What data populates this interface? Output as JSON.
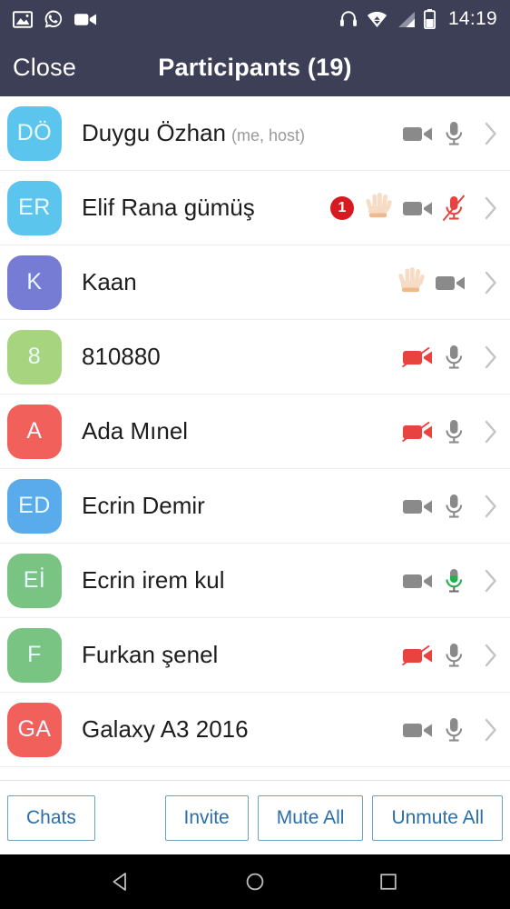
{
  "statusbar": {
    "left_icons": [
      "photo-icon",
      "whatsapp-icon",
      "video-call-icon"
    ],
    "right_icons": [
      "headset-icon",
      "wifi-icon",
      "cellular-signal-icon",
      "battery-icon"
    ],
    "time": "14:19",
    "bg_color": "#3d3f56"
  },
  "titlebar": {
    "close_label": "Close",
    "title": "Participants (19)",
    "bg_color": "#3d3f56"
  },
  "participants": [
    {
      "initials": "DÖ",
      "avatar_color": "#5bc5ee",
      "name": "Duygu Özhan",
      "meta": "(me, host)",
      "hand_raised": false,
      "badge": null,
      "video": "on",
      "mic": "on"
    },
    {
      "initials": "ER",
      "avatar_color": "#5bc5ee",
      "name": "Elif Rana gümüş",
      "meta": "",
      "hand_raised": true,
      "badge": "1",
      "video": "on",
      "mic": "muted"
    },
    {
      "initials": "K",
      "avatar_color": "#767cd4",
      "name": "Kaan",
      "meta": "",
      "hand_raised": true,
      "badge": null,
      "video": "on",
      "mic": "none"
    },
    {
      "initials": "8",
      "avatar_color": "#a7d47e",
      "name": "810880",
      "meta": "",
      "hand_raised": false,
      "badge": null,
      "video": "off",
      "mic": "on"
    },
    {
      "initials": "A",
      "avatar_color": "#f2605c",
      "name": "Ada Mınel",
      "meta": "",
      "hand_raised": false,
      "badge": null,
      "video": "off",
      "mic": "on"
    },
    {
      "initials": "ED",
      "avatar_color": "#5aabec",
      "name": "Ecrin Demir",
      "meta": "",
      "hand_raised": false,
      "badge": null,
      "video": "on",
      "mic": "on"
    },
    {
      "initials": "Eİ",
      "avatar_color": "#79c383",
      "name": "Ecrin irem kul",
      "meta": "",
      "hand_raised": false,
      "badge": null,
      "video": "on",
      "mic": "talking"
    },
    {
      "initials": "F",
      "avatar_color": "#79c383",
      "name": "Furkan şenel",
      "meta": "",
      "hand_raised": false,
      "badge": null,
      "video": "off",
      "mic": "on"
    },
    {
      "initials": "GA",
      "avatar_color": "#f2605c",
      "name": "Galaxy A3 2016",
      "meta": "",
      "hand_raised": false,
      "badge": null,
      "video": "on",
      "mic": "on"
    }
  ],
  "bottombar": {
    "chats_label": "Chats",
    "invite_label": "Invite",
    "mute_all_label": "Mute All",
    "unmute_all_label": "Unmute All",
    "border_color": "#6aa3bd",
    "text_color": "#2b6ea8"
  },
  "navbar": {
    "back_label": "back-icon",
    "home_label": "home-icon",
    "recents_label": "recents-icon"
  },
  "colors": {
    "header": "#3d3f56",
    "muted_red": "#e8433f",
    "talking_green": "#22b14c",
    "badge_red": "#d71920"
  }
}
